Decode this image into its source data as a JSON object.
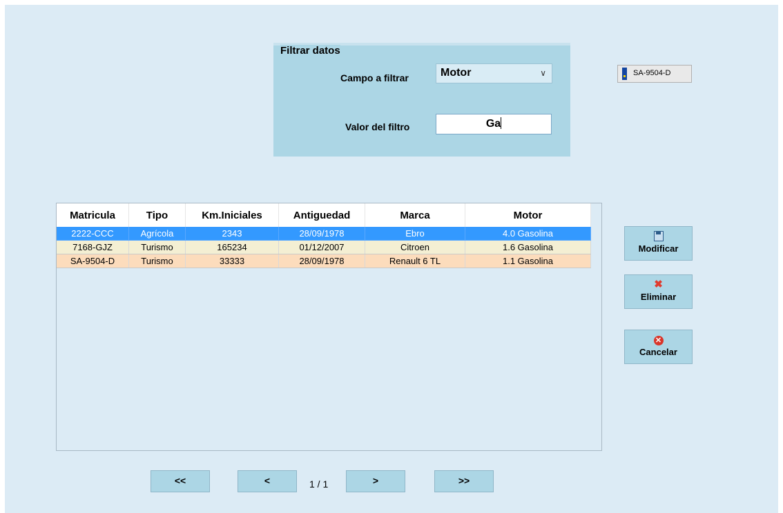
{
  "filter": {
    "legend": "Filtrar datos",
    "field_label": "Campo a filtrar",
    "field_value": "Motor",
    "value_label": "Valor del filtro",
    "value_text": "Ga"
  },
  "plate_button": {
    "label": "SA-9504-D"
  },
  "table": {
    "columns": [
      "Matricula",
      "Tipo",
      "Km.Iniciales",
      "Antiguedad",
      "Marca",
      "Motor"
    ],
    "rows": [
      [
        "2222-CCC",
        "Agrícola",
        "2343",
        "28/09/1978",
        "Ebro",
        "4.0 Gasolina"
      ],
      [
        "7168-GJZ",
        "Turismo",
        "165234",
        "01/12/2007",
        "Citroen",
        "1.6 Gasolina"
      ],
      [
        "SA-9504-D",
        "Turismo",
        "33333",
        "28/09/1978",
        "Renault 6 TL",
        "1.1 Gasolina"
      ]
    ]
  },
  "actions": {
    "modify": "Modificar",
    "delete": "Eliminar",
    "cancel": "Cancelar"
  },
  "pager": {
    "first": "<<",
    "prev": "<",
    "page": "1 / 1",
    "next": ">",
    "last": ">>"
  },
  "colors": {
    "background": "#dcebf5",
    "panel": "#acd6e5",
    "selected_row": "#3399ff",
    "row_alt_1": "#f4efd3",
    "row_alt_2": "#fcdcbc"
  }
}
